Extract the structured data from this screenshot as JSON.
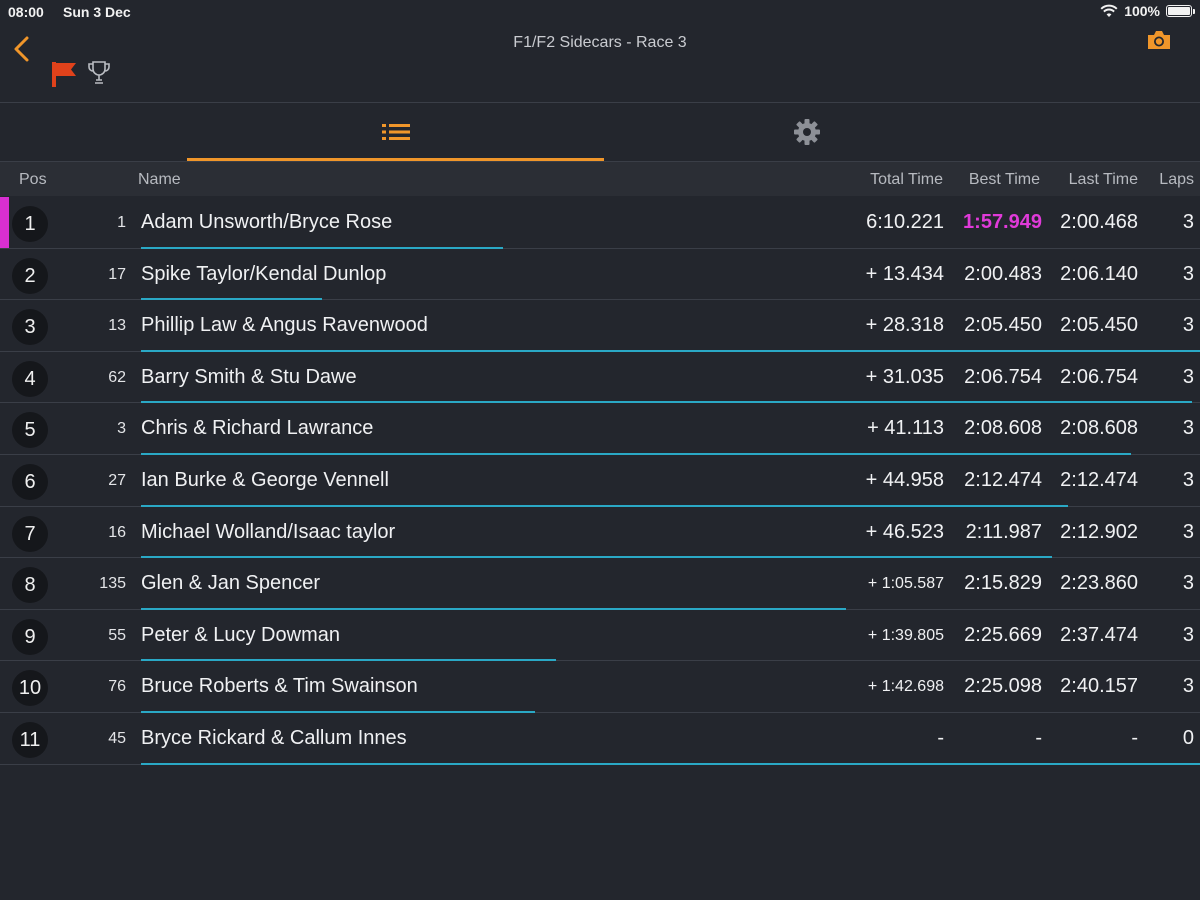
{
  "status": {
    "time": "08:00",
    "date": "Sun 3 Dec",
    "battery": "100%",
    "battery_level": 1.0
  },
  "nav": {
    "title": "F1/F2 Sidecars - Race 3"
  },
  "colors": {
    "accent": "#f0962a",
    "fastest": "#e03ad9",
    "flag": "#e0421b",
    "progress": "#2aa8c5"
  },
  "icons": {
    "back": "chevron-left-icon",
    "flag": "red-flag-icon",
    "trophy": "trophy-icon",
    "camera": "camera-icon",
    "list": "list-icon",
    "settings": "gear-icon"
  },
  "columns": {
    "pos": "Pos",
    "name": "Name",
    "total": "Total Time",
    "best": "Best Time",
    "last": "Last Time",
    "laps": "Laps"
  },
  "rows": [
    {
      "pos": "1",
      "num": "1",
      "name": "Adam Unsworth/Bryce Rose",
      "total": "6:10.221",
      "best": "1:57.949",
      "last": "2:00.468",
      "laps": "3",
      "fastest": true,
      "leader": true,
      "progress": 0.342
    },
    {
      "pos": "2",
      "num": "17",
      "name": "Spike Taylor/Kendal Dunlop",
      "total": "+ 13.434",
      "best": "2:00.483",
      "last": "2:06.140",
      "laps": "3",
      "progress": 0.171
    },
    {
      "pos": "3",
      "num": "13",
      "name": "Phillip Law & Angus Ravenwood",
      "total": "+ 28.318",
      "best": "2:05.450",
      "last": "2:05.450",
      "laps": "3",
      "progress": 1.0
    },
    {
      "pos": "4",
      "num": "62",
      "name": "Barry Smith & Stu Dawe",
      "total": "+ 31.035",
      "best": "2:06.754",
      "last": "2:06.754",
      "laps": "3",
      "progress": 0.992
    },
    {
      "pos": "5",
      "num": "3",
      "name": "Chris & Richard Lawrance",
      "total": "+ 41.113",
      "best": "2:08.608",
      "last": "2:08.608",
      "laps": "3",
      "progress": 0.935
    },
    {
      "pos": "6",
      "num": "27",
      "name": "Ian Burke & George Vennell",
      "total": "+ 44.958",
      "best": "2:12.474",
      "last": "2:12.474",
      "laps": "3",
      "progress": 0.875
    },
    {
      "pos": "7",
      "num": "16",
      "name": "Michael Wolland/Isaac taylor",
      "total": "+ 46.523",
      "best": "2:11.987",
      "last": "2:12.902",
      "laps": "3",
      "progress": 0.86
    },
    {
      "pos": "8",
      "num": "135",
      "name": "Glen & Jan Spencer",
      "total": "+ 1:05.587",
      "best": "2:15.829",
      "last": "2:23.860",
      "laps": "3",
      "progress": 0.666
    },
    {
      "pos": "9",
      "num": "55",
      "name": "Peter & Lucy Dowman",
      "total": "+ 1:39.805",
      "best": "2:25.669",
      "last": "2:37.474",
      "laps": "3",
      "progress": 0.392
    },
    {
      "pos": "10",
      "num": "76",
      "name": "Bruce Roberts & Tim Swainson",
      "total": "+ 1:42.698",
      "best": "2:25.098",
      "last": "2:40.157",
      "laps": "3",
      "progress": 0.372
    },
    {
      "pos": "11",
      "num": "45",
      "name": "Bryce Rickard & Callum Innes",
      "total": "-",
      "best": "-",
      "last": "-",
      "laps": "0",
      "progress": 1.0
    }
  ]
}
